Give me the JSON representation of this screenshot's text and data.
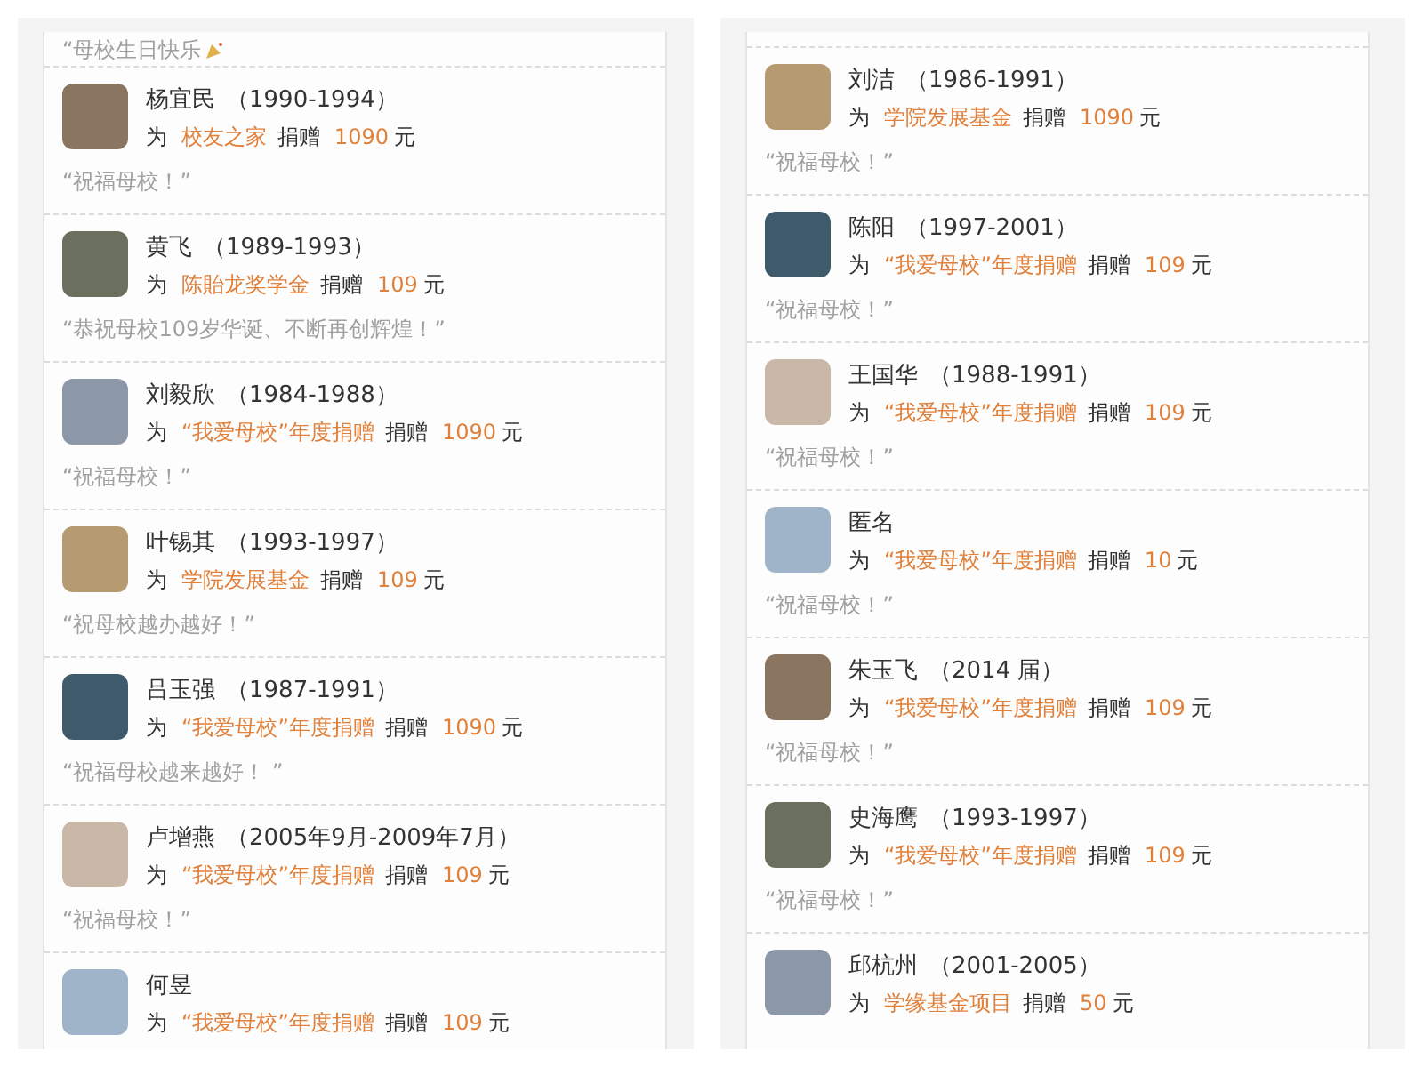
{
  "panels": [
    {
      "top_message": "“母校生日快乐",
      "donations": [
        {
          "name": "杨宜民",
          "years": "（1990-1994）",
          "prefix": "为",
          "fund": "校友之家",
          "verb": "捐赠",
          "amount": "1090",
          "unit": "元",
          "message": "“祝福母校！”"
        },
        {
          "name": "黄飞",
          "years": "（1989-1993）",
          "prefix": "为",
          "fund": "陈貽龙奖学金",
          "verb": "捐赠",
          "amount": "109",
          "unit": "元",
          "message": "“恭祝母校109岁华诞、不断再创辉煌！”"
        },
        {
          "name": "刘毅欣",
          "years": "（1984-1988）",
          "prefix": "为",
          "fund": "“我爱母校”年度捐赠",
          "verb": "捐赠",
          "amount": "1090",
          "unit": "元",
          "message": "“祝福母校！”"
        },
        {
          "name": "叶锡其",
          "years": "（1993-1997）",
          "prefix": "为",
          "fund": "学院发展基金",
          "verb": "捐赠",
          "amount": "109",
          "unit": "元",
          "message": "“祝母校越办越好！”"
        },
        {
          "name": "吕玉强",
          "years": "（1987-1991）",
          "prefix": "为",
          "fund": "“我爱母校”年度捐赠",
          "verb": "捐赠",
          "amount": "1090",
          "unit": "元",
          "message": "“祝福母校越来越好！ ”"
        },
        {
          "name": "卢增燕",
          "years": "（2005年9月-2009年7月）",
          "prefix": "为",
          "fund": "“我爱母校”年度捐赠",
          "verb": "捐赠",
          "amount": "109",
          "unit": "元",
          "message": "“祝福母校！”"
        },
        {
          "name": "何昱",
          "prefix": "为",
          "fund": "“我爱母校”年度捐赠",
          "verb": "捐赠",
          "amount": "109",
          "unit": "元"
        }
      ]
    },
    {
      "donations": [
        {
          "name": "刘洁",
          "years": "（1986-1991）",
          "prefix": "为",
          "fund": "学院发展基金",
          "verb": "捐赠",
          "amount": "1090",
          "unit": "元",
          "message": "“祝福母校！”"
        },
        {
          "name": "陈阳",
          "years": "（1997-2001）",
          "prefix": "为",
          "fund": "“我爱母校”年度捐赠",
          "verb": "捐赠",
          "amount": "109",
          "unit": "元",
          "message": "“祝福母校！”"
        },
        {
          "name": "王国华",
          "years": "（1988-1991）",
          "prefix": "为",
          "fund": "“我爱母校”年度捐赠",
          "verb": "捐赠",
          "amount": "109",
          "unit": "元",
          "message": "“祝福母校！”"
        },
        {
          "name": "匿名",
          "prefix": "为",
          "fund": "“我爱母校”年度捐赠",
          "verb": "捐赠",
          "amount": "10",
          "unit": "元",
          "message": "“祝福母校！”"
        },
        {
          "name": "朱玉飞",
          "years": "（2014 届）",
          "prefix": "为",
          "fund": "“我爱母校”年度捐赠",
          "verb": "捐赠",
          "amount": "109",
          "unit": "元",
          "message": "“祝福母校！”"
        },
        {
          "name": "史海鹰",
          "years": "（1993-1997）",
          "prefix": "为",
          "fund": "“我爱母校”年度捐赠",
          "verb": "捐赠",
          "amount": "109",
          "unit": "元",
          "message": "“祝福母校！”"
        },
        {
          "name": "邱杭州",
          "years": "（2001-2005）",
          "prefix": "为",
          "fund": "学缘基金项目",
          "verb": "捐赠",
          "amount": "50",
          "unit": "元"
        }
      ]
    }
  ]
}
